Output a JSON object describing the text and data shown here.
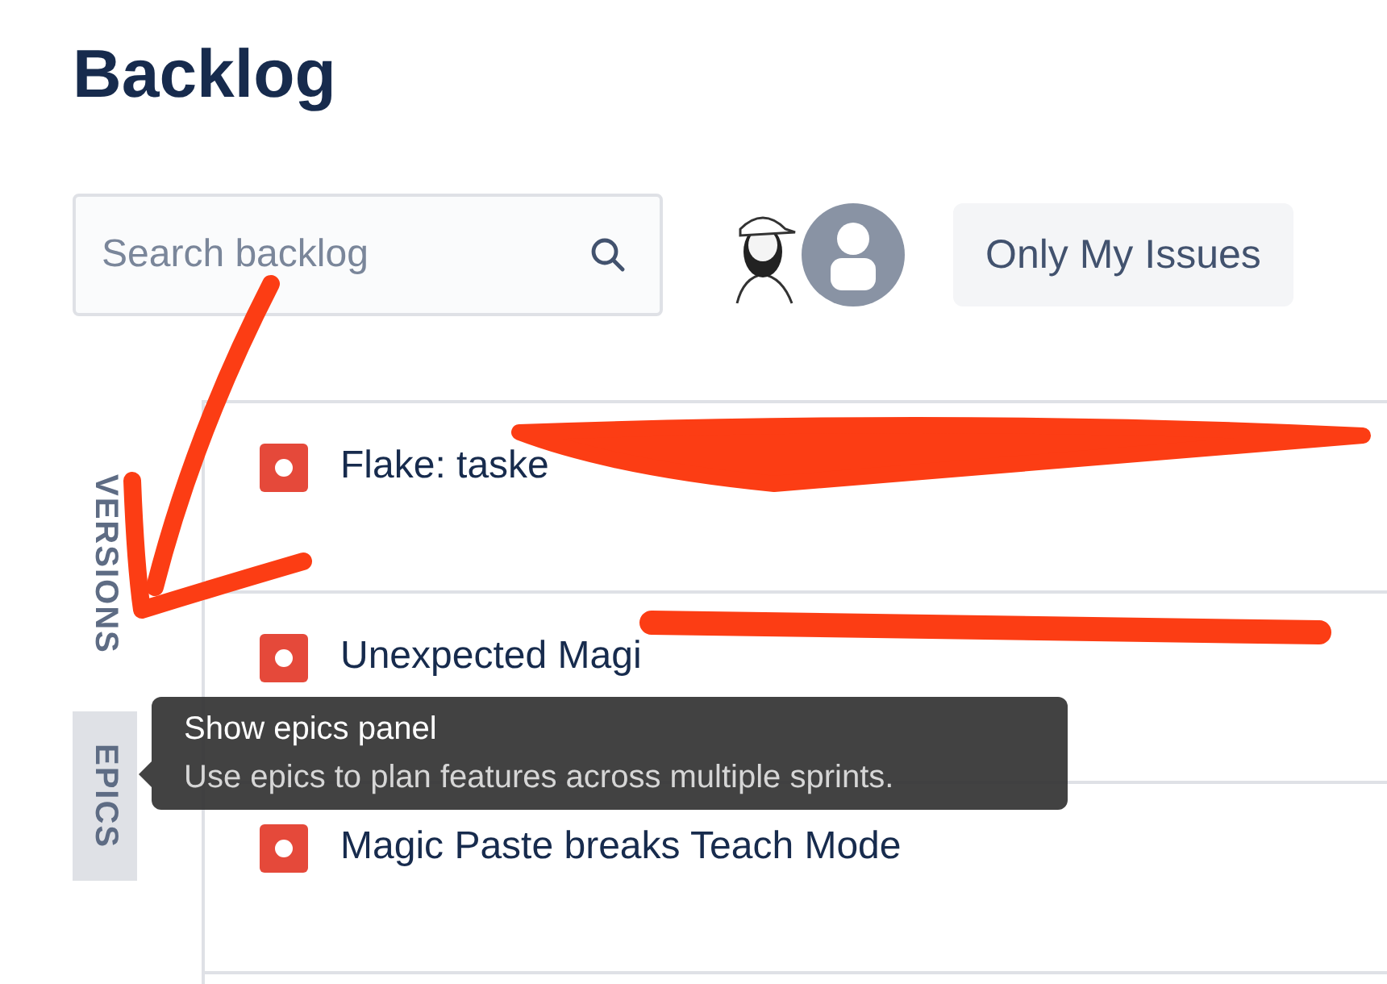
{
  "page": {
    "title": "Backlog"
  },
  "search": {
    "placeholder": "Search backlog"
  },
  "avatars": [
    {
      "kind": "figure"
    },
    {
      "kind": "default"
    }
  ],
  "quick_filter": {
    "label": "Only My Issues"
  },
  "side_tabs": [
    {
      "label": "VERSIONS",
      "selected": false
    },
    {
      "label": "EPICS",
      "selected": true
    }
  ],
  "issues": [
    {
      "kind": "bug",
      "title": "Flake: taske"
    },
    {
      "kind": "bug",
      "title": "Unexpected Magi"
    },
    {
      "kind": "bug",
      "title": "Magic Paste breaks Teach Mode"
    }
  ],
  "tooltip": {
    "title": "Show epics panel",
    "body": "Use epics to plan features across multiple sprints."
  }
}
